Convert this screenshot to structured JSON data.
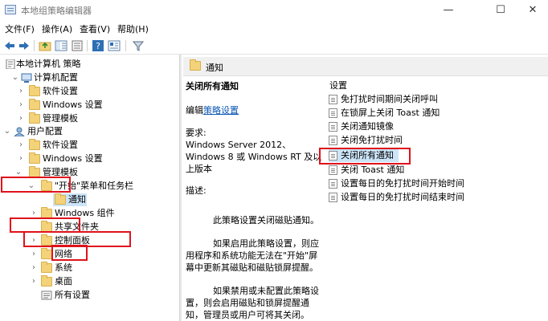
{
  "window": {
    "title": "本地组策略编辑器",
    "min": "—",
    "max": "☐",
    "close": "✕"
  },
  "menus": [
    "文件(F)",
    "操作(A)",
    "查看(V)",
    "帮助(H)"
  ],
  "tree": {
    "root": "本地计算机 策略",
    "computer_config": "计算机配置",
    "cc_software": "软件设置",
    "cc_windows": "Windows 设置",
    "cc_admin": "管理模板",
    "user_config": "用户配置",
    "uc_software": "软件设置",
    "uc_windows": "Windows 设置",
    "uc_admin": "管理模板",
    "start_menu": "\"开始\"菜单和任务栏",
    "notifications": "通知",
    "windows_components": "Windows 组件",
    "shared_folders": "共享文件夹",
    "control_panel": "控制面板",
    "network": "网络",
    "system": "系统",
    "desktop": "桌面",
    "all_settings": "所有设置"
  },
  "right": {
    "header": "通知",
    "policy_title": "关闭所有通知",
    "edit_prefix": "编辑",
    "edit_link": "策略设置",
    "requirements_label": "要求:",
    "requirements_text": "Windows Server 2012、Windows 8 或 Windows RT 及以上版本",
    "description_label": "描述:",
    "desc_p1": "此策略设置关闭磁贴通知。",
    "desc_p2": "如果启用此策略设置，则应用程序和系统功能无法在\"开始\"屏幕中更新其磁贴和磁贴锁屏提醒。",
    "desc_p3": "如果禁用或未配置此策略设置，则会启用磁贴和锁屏提醒通知，管理员或用户可将其关闭。",
    "settings_header": "设置",
    "settings": [
      "免打扰时间期间关闭呼叫",
      "在锁屏上关闭 Toast 通知",
      "关闭通知镜像",
      "关闭免打扰时间",
      "关闭所有通知",
      "关闭 Toast 通知",
      "设置每日的免打扰时间开始时间",
      "设置每日的免打扰时间结束时间"
    ]
  }
}
